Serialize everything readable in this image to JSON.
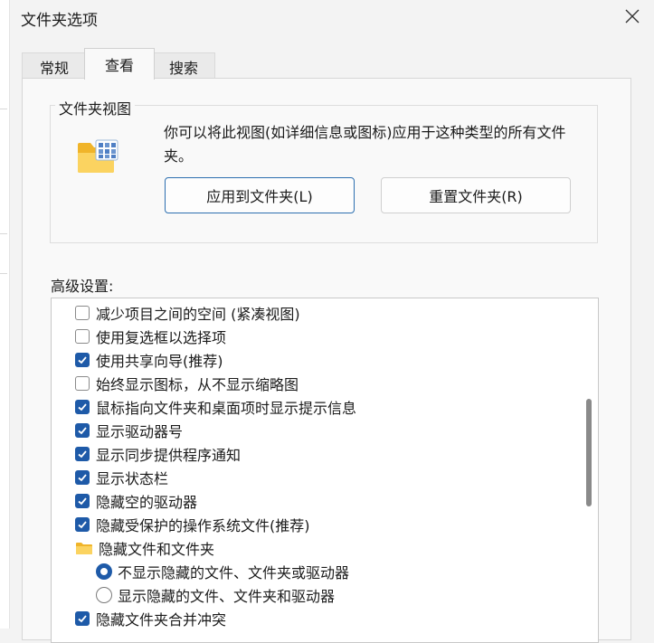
{
  "window": {
    "title": "文件夹选项"
  },
  "tabs": [
    {
      "label": "常规",
      "active": false
    },
    {
      "label": "查看",
      "active": true
    },
    {
      "label": "搜索",
      "active": false
    }
  ],
  "folder_views": {
    "title": "文件夹视图",
    "description": "你可以将此视图(如详细信息或图标)应用于这种类型的所有文件夹。",
    "apply_button": "应用到文件夹(L)",
    "reset_button": "重置文件夹(R)"
  },
  "advanced": {
    "label": "高级设置:",
    "items": [
      {
        "type": "checkbox",
        "label": "减少项目之间的空间 (紧凑视图)",
        "checked": false
      },
      {
        "type": "checkbox",
        "label": "使用复选框以选择项",
        "checked": false
      },
      {
        "type": "checkbox",
        "label": "使用共享向导(推荐)",
        "checked": true
      },
      {
        "type": "checkbox",
        "label": "始终显示图标，从不显示缩略图",
        "checked": false
      },
      {
        "type": "checkbox",
        "label": "鼠标指向文件夹和桌面项时显示提示信息",
        "checked": true
      },
      {
        "type": "checkbox",
        "label": "显示驱动器号",
        "checked": true
      },
      {
        "type": "checkbox",
        "label": "显示同步提供程序通知",
        "checked": true
      },
      {
        "type": "checkbox",
        "label": "显示状态栏",
        "checked": true
      },
      {
        "type": "checkbox",
        "label": "隐藏空的驱动器",
        "checked": true
      },
      {
        "type": "checkbox",
        "label": "隐藏受保护的操作系统文件(推荐)",
        "checked": true
      },
      {
        "type": "folder",
        "label": "隐藏文件和文件夹"
      },
      {
        "type": "radio",
        "label": "不显示隐藏的文件、文件夹或驱动器",
        "checked": true
      },
      {
        "type": "radio",
        "label": "显示隐藏的文件、文件夹和驱动器",
        "checked": false
      },
      {
        "type": "checkbox",
        "label": "隐藏文件夹合并冲突",
        "checked": true
      }
    ]
  },
  "colors": {
    "accent": "#1e5aa8",
    "folder": "#f5c542"
  }
}
